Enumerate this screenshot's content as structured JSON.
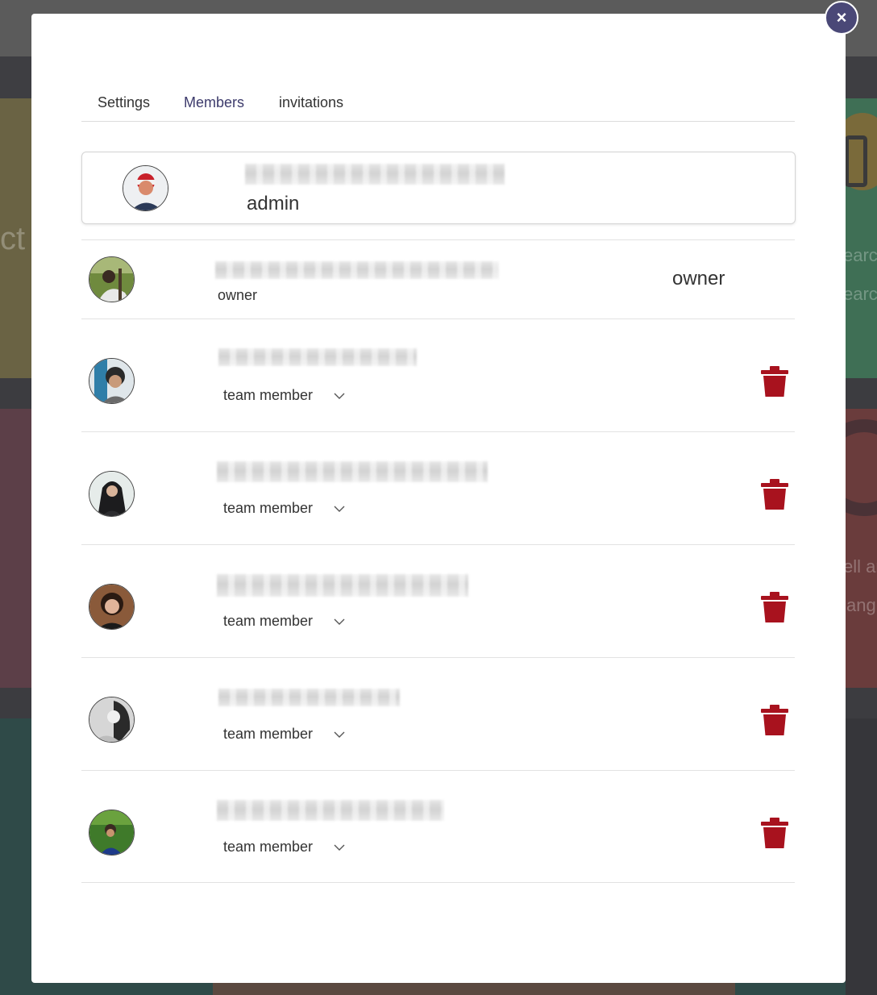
{
  "background": {
    "texts": [
      "ct",
      "earc",
      "earc",
      "ell ar",
      "ang"
    ]
  },
  "modal": {
    "close_label": "×",
    "tabs": [
      {
        "label": "Settings"
      },
      {
        "label": "Members"
      },
      {
        "label": "invitations"
      }
    ],
    "active_tab": "Members",
    "current_user": {
      "role": "admin"
    },
    "owner": {
      "role_subtitle": "owner",
      "role_right": "owner"
    },
    "members": [
      {
        "role": "team member"
      },
      {
        "role": "team member"
      },
      {
        "role": "team member"
      },
      {
        "role": "team member"
      },
      {
        "role": "team member"
      }
    ]
  },
  "colors": {
    "accent": "#3d3b6c",
    "close_button": "#4a4877",
    "delete_icon": "#a8121e"
  },
  "icons": {
    "close": "close-icon",
    "chevron": "chevron-down-icon",
    "delete": "trash-icon"
  }
}
